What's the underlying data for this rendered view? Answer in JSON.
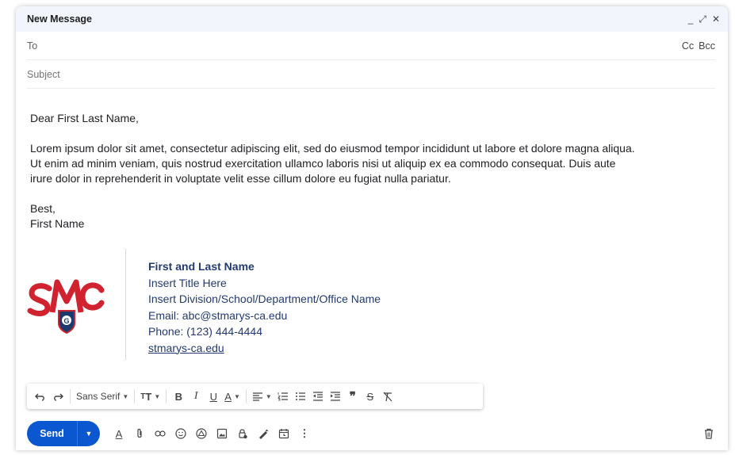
{
  "window": {
    "title": "New Message",
    "minimize": "_",
    "popout": "⤢",
    "close": "✕"
  },
  "recipients": {
    "to_label": "To",
    "to_value": "",
    "cc": "Cc",
    "bcc": "Bcc"
  },
  "subject": {
    "placeholder": "Subject",
    "value": ""
  },
  "body": {
    "greeting": "Dear First Last Name,",
    "paragraph": "Lorem ipsum dolor sit amet, consectetur adipiscing elit, sed do eiusmod tempor incididunt ut labore et dolore magna aliqua. Ut enim ad minim veniam, quis nostrud exercitation ullamco laboris nisi ut aliquip ex ea commodo consequat. Duis aute irure dolor in reprehenderit in voluptate velit esse cillum dolore eu fugiat nulla pariatur.",
    "closing": "Best,",
    "sender": "First Name"
  },
  "signature": {
    "name": "First and Last Name",
    "title": "Insert Title Here",
    "division": "Insert Division/School/Department/Office Name",
    "email": "Email: abc@stmarys-ca.edu",
    "phone": "Phone: (123) 444-4444",
    "website": "stmarys-ca.edu",
    "logo_colors": {
      "red": "#d1222f",
      "navy": "#1c3a6e"
    }
  },
  "format_toolbar": {
    "font": "Sans Serif",
    "items": [
      "undo-icon",
      "redo-icon",
      "font-family",
      "text-size-icon",
      "bold-icon",
      "italic-icon",
      "underline-icon",
      "text-color-icon",
      "align-icon",
      "numbered-list-icon",
      "bulleted-list-icon",
      "indent-less-icon",
      "indent-more-icon",
      "quote-icon",
      "strikethrough-icon",
      "remove-formatting-icon"
    ]
  },
  "bottom_bar": {
    "send_label": "Send",
    "tools": [
      "formatting-options-icon",
      "attach-icon",
      "link-icon",
      "emoji-icon",
      "drive-icon",
      "photo-icon",
      "confidential-icon",
      "signature-icon",
      "schedule-icon",
      "more-options-icon"
    ],
    "trash": "trash-icon"
  },
  "colors": {
    "accent": "#0b57d0",
    "titlebar_bg": "#f2f6fc",
    "signature_text": "#233a70"
  }
}
